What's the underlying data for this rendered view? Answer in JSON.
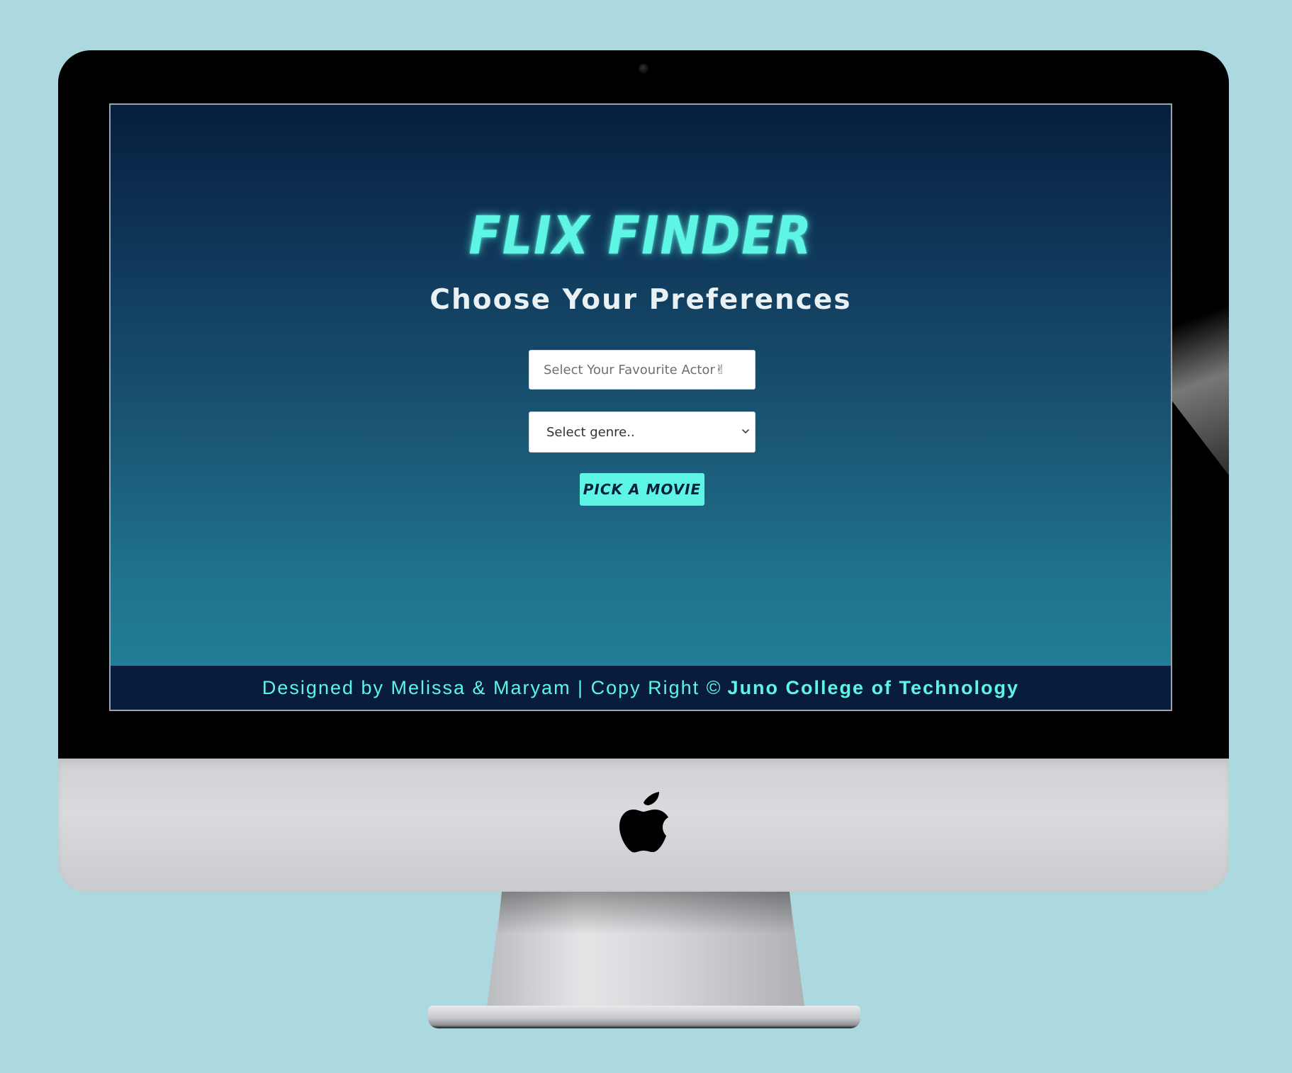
{
  "site": {
    "title": "FLIX FINDER",
    "subtitle": "Choose Your Preferences"
  },
  "form": {
    "actor_placeholder": "Select Your Favourite Actor✌",
    "genre_selected": "Select genre..",
    "submit_label": "Pick a Movie"
  },
  "footer": {
    "credit_text": "Designed by Melissa & Maryam | Copy Right ©",
    "school_text": "Juno College of Technology"
  },
  "colors": {
    "accent": "#5ef5e4",
    "page_gradient_top": "#071e3e",
    "page_gradient_bottom": "#238299",
    "footer_bg": "#081d3e",
    "backdrop": "#acd9e0"
  },
  "icons": {
    "monitor_logo": "apple-logo-icon",
    "select_arrow": "chevron-down-icon",
    "camera": "camera-icon"
  }
}
